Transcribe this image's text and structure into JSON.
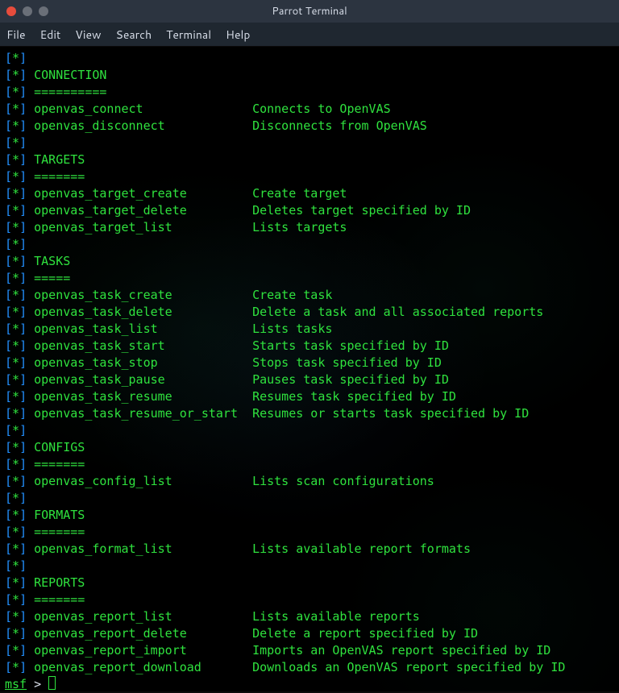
{
  "window": {
    "title": "Parrot Terminal"
  },
  "menu": {
    "file": "File",
    "edit": "Edit",
    "view": "View",
    "search": "Search",
    "terminal": "Terminal",
    "help": "Help"
  },
  "marker": {
    "open": "[",
    "star": "*",
    "close": "]"
  },
  "sections": {
    "connection": {
      "title": "CONNECTION",
      "rule": "=========="
    },
    "targets": {
      "title": "TARGETS",
      "rule": "======="
    },
    "tasks": {
      "title": "TASKS",
      "rule": "====="
    },
    "configs": {
      "title": "CONFIGS",
      "rule": "======="
    },
    "formats": {
      "title": "FORMATS",
      "rule": "======="
    },
    "reports": {
      "title": "REPORTS",
      "rule": "======="
    }
  },
  "cmds": {
    "openvas_connect": {
      "name": "openvas_connect",
      "pad": "               ",
      "desc": "Connects to OpenVAS"
    },
    "openvas_disconnect": {
      "name": "openvas_disconnect",
      "pad": "            ",
      "desc": "Disconnects from OpenVAS"
    },
    "openvas_target_create": {
      "name": "openvas_target_create",
      "pad": "         ",
      "desc": "Create target"
    },
    "openvas_target_delete": {
      "name": "openvas_target_delete",
      "pad": "         ",
      "desc": "Deletes target specified by ID"
    },
    "openvas_target_list": {
      "name": "openvas_target_list",
      "pad": "           ",
      "desc": "Lists targets"
    },
    "openvas_task_create": {
      "name": "openvas_task_create",
      "pad": "           ",
      "desc": "Create task"
    },
    "openvas_task_delete": {
      "name": "openvas_task_delete",
      "pad": "           ",
      "desc": "Delete a task and all associated reports"
    },
    "openvas_task_list": {
      "name": "openvas_task_list",
      "pad": "             ",
      "desc": "Lists tasks"
    },
    "openvas_task_start": {
      "name": "openvas_task_start",
      "pad": "            ",
      "desc": "Starts task specified by ID"
    },
    "openvas_task_stop": {
      "name": "openvas_task_stop",
      "pad": "             ",
      "desc": "Stops task specified by ID"
    },
    "openvas_task_pause": {
      "name": "openvas_task_pause",
      "pad": "            ",
      "desc": "Pauses task specified by ID"
    },
    "openvas_task_resume": {
      "name": "openvas_task_resume",
      "pad": "           ",
      "desc": "Resumes task specified by ID"
    },
    "openvas_task_resume_or_start": {
      "name": "openvas_task_resume_or_start",
      "pad": "  ",
      "desc": "Resumes or starts task specified by ID"
    },
    "openvas_config_list": {
      "name": "openvas_config_list",
      "pad": "           ",
      "desc": "Lists scan configurations"
    },
    "openvas_format_list": {
      "name": "openvas_format_list",
      "pad": "           ",
      "desc": "Lists available report formats"
    },
    "openvas_report_list": {
      "name": "openvas_report_list",
      "pad": "           ",
      "desc": "Lists available reports"
    },
    "openvas_report_delete": {
      "name": "openvas_report_delete",
      "pad": "         ",
      "desc": "Delete a report specified by ID"
    },
    "openvas_report_import": {
      "name": "openvas_report_import",
      "pad": "         ",
      "desc": "Imports an OpenVAS report specified by ID"
    },
    "openvas_report_download": {
      "name": "openvas_report_download",
      "pad": "       ",
      "desc": "Downloads an OpenVAS report specified by ID"
    }
  },
  "prompt": {
    "msf": "msf",
    "gt": " > "
  }
}
